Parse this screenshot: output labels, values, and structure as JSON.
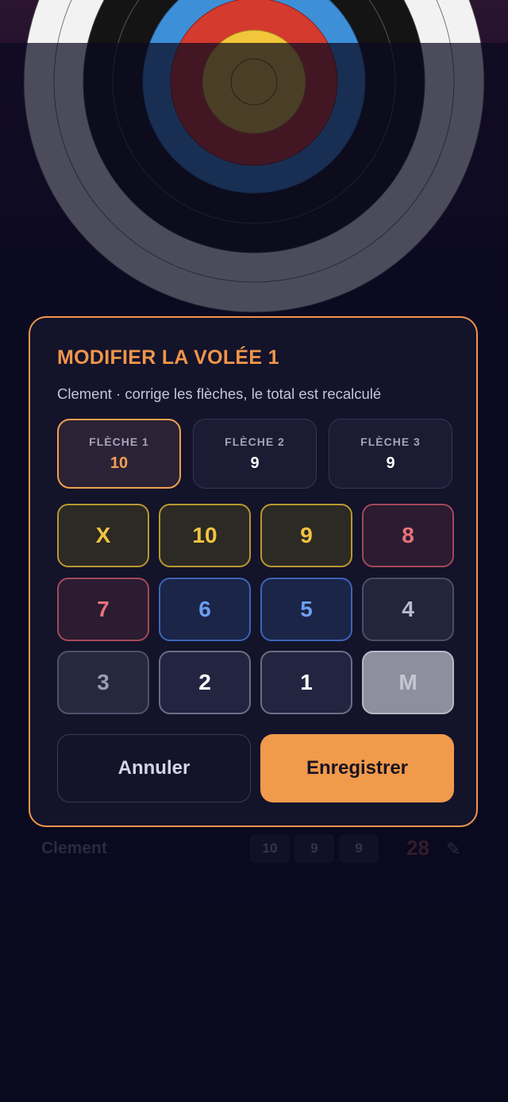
{
  "modal": {
    "title": "MODIFIER LA VOLÉE 1",
    "subtitle": "Clement · corrige les flèches, le total est recalculé",
    "arrows": [
      {
        "label": "FLÈCHE 1",
        "value": "10",
        "active": true
      },
      {
        "label": "FLÈCHE 2",
        "value": "9",
        "active": false
      },
      {
        "label": "FLÈCHE 3",
        "value": "9",
        "active": false
      }
    ],
    "keypad": [
      "X",
      "10",
      "9",
      "8",
      "7",
      "6",
      "5",
      "4",
      "3",
      "2",
      "1",
      "M"
    ],
    "cancel_label": "Annuler",
    "save_label": "Enregistrer"
  },
  "background_row": {
    "name": "Clement",
    "scores": [
      "10",
      "9",
      "9"
    ],
    "total": "28",
    "edit_icon": "pencil-icon"
  },
  "colors": {
    "accent": "#f0954a",
    "gold": "#f2c342",
    "red": "#e8727a",
    "blue": "#6e9ef0",
    "background": "#0a0a1e"
  }
}
